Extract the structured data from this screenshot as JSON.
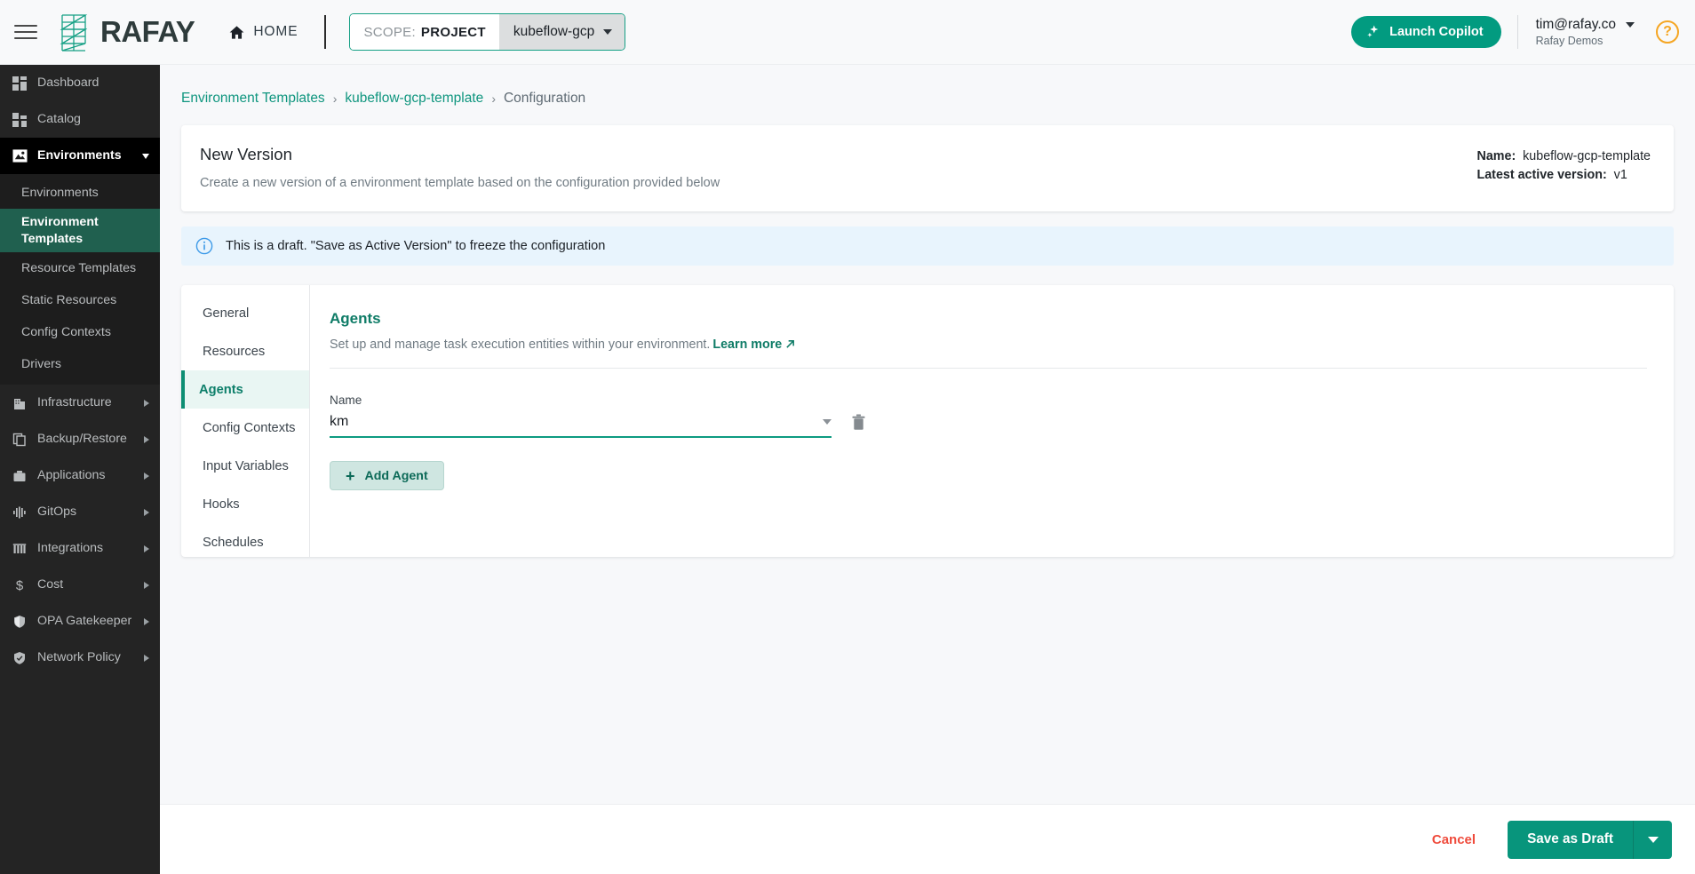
{
  "header": {
    "menu_icon": "hamburger-icon",
    "brand": "RAFAY",
    "home_label": "HOME",
    "scope_key": "SCOPE:",
    "scope_value": "PROJECT",
    "scope_project": "kubeflow-gcp",
    "copilot_label": "Launch Copilot",
    "user_email": "tim@rafay.co",
    "user_org": "Rafay Demos",
    "help_label": "?"
  },
  "sidebar": {
    "items": [
      {
        "label": "Dashboard",
        "icon": "dashboard-icon",
        "has_chevron": false
      },
      {
        "label": "Catalog",
        "icon": "catalog-icon",
        "has_chevron": false
      },
      {
        "label": "Environments",
        "icon": "environments-icon",
        "has_chevron": true,
        "expanded": true
      }
    ],
    "sub_items": [
      {
        "label": "Environments",
        "selected": false
      },
      {
        "label": "Environment Templates",
        "selected": true
      },
      {
        "label": "Resource Templates",
        "selected": false
      },
      {
        "label": "Static Resources",
        "selected": false
      },
      {
        "label": "Config Contexts",
        "selected": false
      },
      {
        "label": "Drivers",
        "selected": false
      }
    ],
    "items_bottom": [
      {
        "label": "Infrastructure",
        "icon": "building-icon",
        "has_chevron": true
      },
      {
        "label": "Backup/Restore",
        "icon": "copy-icon",
        "has_chevron": true
      },
      {
        "label": "Applications",
        "icon": "briefcase-icon",
        "has_chevron": true
      },
      {
        "label": "GitOps",
        "icon": "pipeline-icon",
        "has_chevron": true
      },
      {
        "label": "Integrations",
        "icon": "integrations-icon",
        "has_chevron": true
      },
      {
        "label": "Cost",
        "icon": "dollar-icon",
        "has_chevron": true
      },
      {
        "label": "OPA Gatekeeper",
        "icon": "shield-icon",
        "has_chevron": true
      },
      {
        "label": "Network Policy",
        "icon": "shield-check-icon",
        "has_chevron": true
      }
    ]
  },
  "breadcrumb": {
    "root": "Environment Templates",
    "sep": "›",
    "template": "kubeflow-gcp-template",
    "current": "Configuration"
  },
  "version_card": {
    "title": "New Version",
    "subtitle": "Create a new version of a environment template based on the configuration provided below",
    "name_key": "Name:",
    "name_value": "kubeflow-gcp-template",
    "version_key": "Latest active version:",
    "version_value": "v1"
  },
  "banner": {
    "icon": "info-icon",
    "text": "This is a draft. \"Save as Active Version\" to freeze the configuration"
  },
  "panel": {
    "tabs": [
      {
        "label": "General",
        "active": false
      },
      {
        "label": "Resources",
        "active": false
      },
      {
        "label": "Agents",
        "active": true
      },
      {
        "label": "Config Contexts",
        "active": false
      },
      {
        "label": "Input Variables",
        "active": false
      },
      {
        "label": "Hooks",
        "active": false
      },
      {
        "label": "Schedules",
        "active": false
      }
    ],
    "section_title": "Agents",
    "section_subtitle": "Set up and manage task execution entities within your environment.",
    "learn_more": "Learn more",
    "learn_more_icon": "external-link-icon",
    "field_label": "Name",
    "field_value": "km",
    "delete_icon": "trash-icon",
    "add_button": "Add Agent",
    "add_icon": "plus-icon"
  },
  "footer": {
    "cancel_label": "Cancel",
    "save_label": "Save as Draft",
    "save_caret_icon": "chevron-down-icon"
  },
  "colors": {
    "accent_teal": "#08957c",
    "sidebar_bg": "#242424",
    "selected_nav": "#20604f",
    "danger_red": "#ef4b3c",
    "info_blue": "#e8f4fd",
    "help_orange": "#f5a623"
  }
}
